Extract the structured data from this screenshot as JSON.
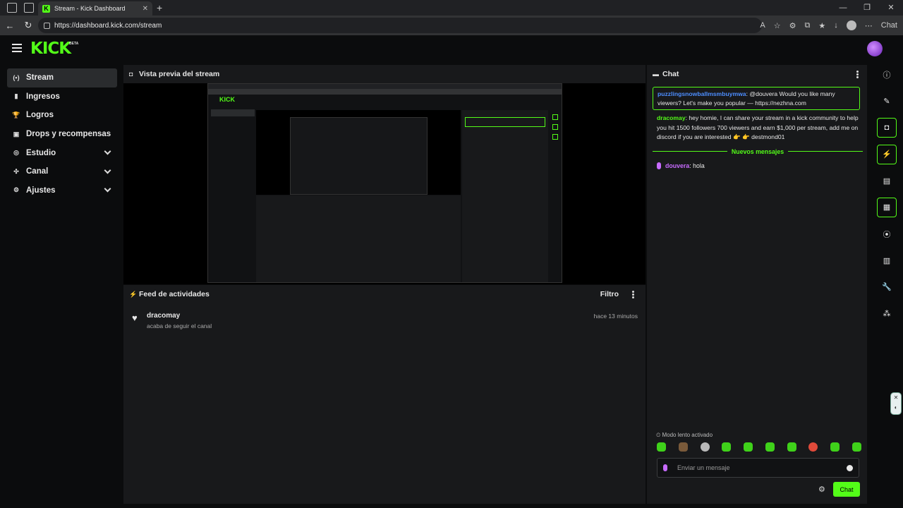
{
  "browser": {
    "tab_title": "Stream - Kick Dashboard",
    "url": "https://dashboard.kick.com/stream",
    "copilot_label": "Chat"
  },
  "app": {
    "logo": "KICK",
    "logo_badge": "BETA",
    "accent": "#53fc18"
  },
  "sidebar": {
    "items": [
      {
        "label": "Stream",
        "icon": "broadcast-icon",
        "glyph": "(•)",
        "active": true
      },
      {
        "label": "Ingresos",
        "icon": "bar-chart-icon",
        "glyph": "▮"
      },
      {
        "label": "Logros",
        "icon": "trophy-icon",
        "glyph": "🏆"
      },
      {
        "label": "Drops y recompensas",
        "icon": "gift-icon",
        "glyph": "▣"
      },
      {
        "label": "Estudio",
        "icon": "studio-icon",
        "glyph": "◎",
        "expandable": true
      },
      {
        "label": "Canal",
        "icon": "channel-icon",
        "glyph": "✣",
        "expandable": true
      },
      {
        "label": "Ajustes",
        "icon": "gear-icon",
        "glyph": "⚙",
        "expandable": true
      }
    ]
  },
  "preview": {
    "title": "Vista previa del stream"
  },
  "feed": {
    "title": "Feed de actividades",
    "filter_label": "Filtro",
    "items": [
      {
        "user": "dracomay",
        "text": "acaba de seguir el canal",
        "time": "hace 13 minutos"
      }
    ]
  },
  "chat": {
    "title": "Chat",
    "messages": [
      {
        "user": "puzzlingsnowballmsmbuymwa",
        "text": ": @douvera Would you like many viewers? Let's make you popular — https://nezhna.com",
        "highlight": true
      },
      {
        "user": "dracomay",
        "text": ": hey homie, I can share your stream in a kick community to help you hit 1500 followers 700 viewers and earn $1,000 per stream, add me on discord if you are interested 👉 👉 destmond01"
      }
    ],
    "new_messages_label": "Nuevos mensajes",
    "new_message": {
      "user": "douvera",
      "text": ": hola"
    },
    "slow_mode": "Modo lento activado",
    "input_placeholder": "Enviar un mensaje",
    "send_label": "Chat"
  }
}
